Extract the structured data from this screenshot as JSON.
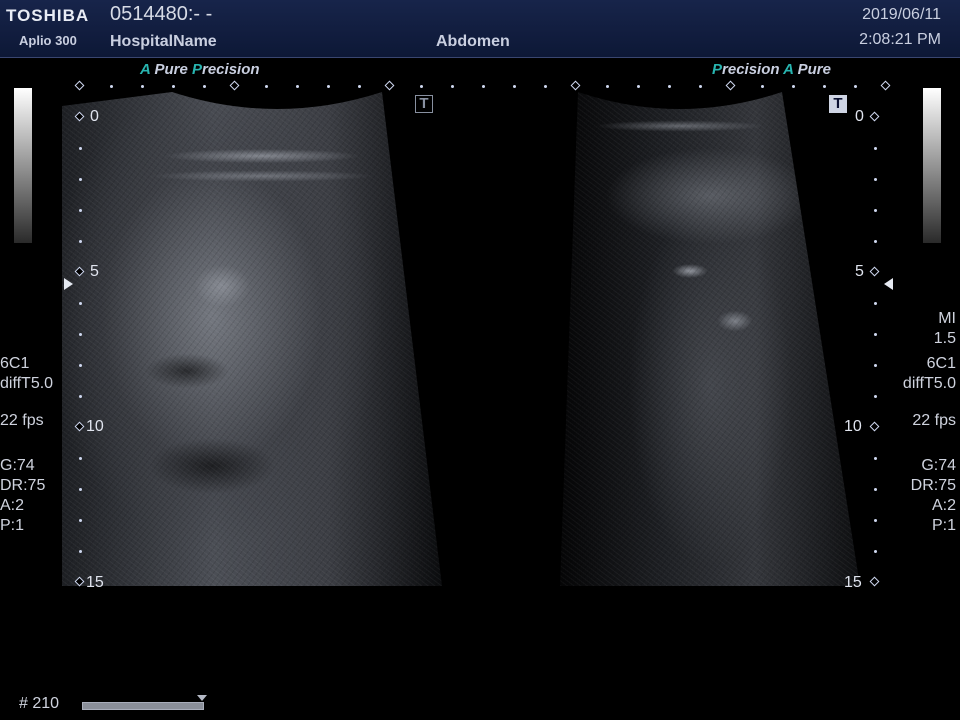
{
  "header": {
    "brand": "TOSHIBA",
    "model": "Aplio 300",
    "patient_id": "0514480:- -",
    "hospital": "HospitalName",
    "exam": "Abdomen",
    "date": "2019/06/11",
    "time": "2:08:21 PM"
  },
  "mode_labels": {
    "left": {
      "a": "A",
      "pure": "Pure",
      "p": "P",
      "recision": "recision"
    },
    "right": {
      "p": "P",
      "recision": "recision",
      "a": "A",
      "pure": "Pure"
    }
  },
  "t_marker": "T",
  "depth_scale": [
    "0",
    "5",
    "10",
    "15"
  ],
  "left_panel": {
    "probe": "6C1",
    "filter": "diffT5.0",
    "fps": "22 fps",
    "gain": "G:74",
    "dr": "DR:75",
    "a": "A:2",
    "p": "P:1"
  },
  "right_panel": {
    "mi_label": "MI",
    "mi_value": "1.5",
    "probe": "6C1",
    "filter": "diffT5.0",
    "fps": "22 fps",
    "gain": "G:74",
    "dr": "DR:75",
    "a": "A:2",
    "p": "P:1"
  },
  "cine": {
    "frame": "# 210"
  },
  "colors": {
    "header_bg": "#17244a",
    "accent": "#28b5b0",
    "text": "#cfd3de"
  }
}
